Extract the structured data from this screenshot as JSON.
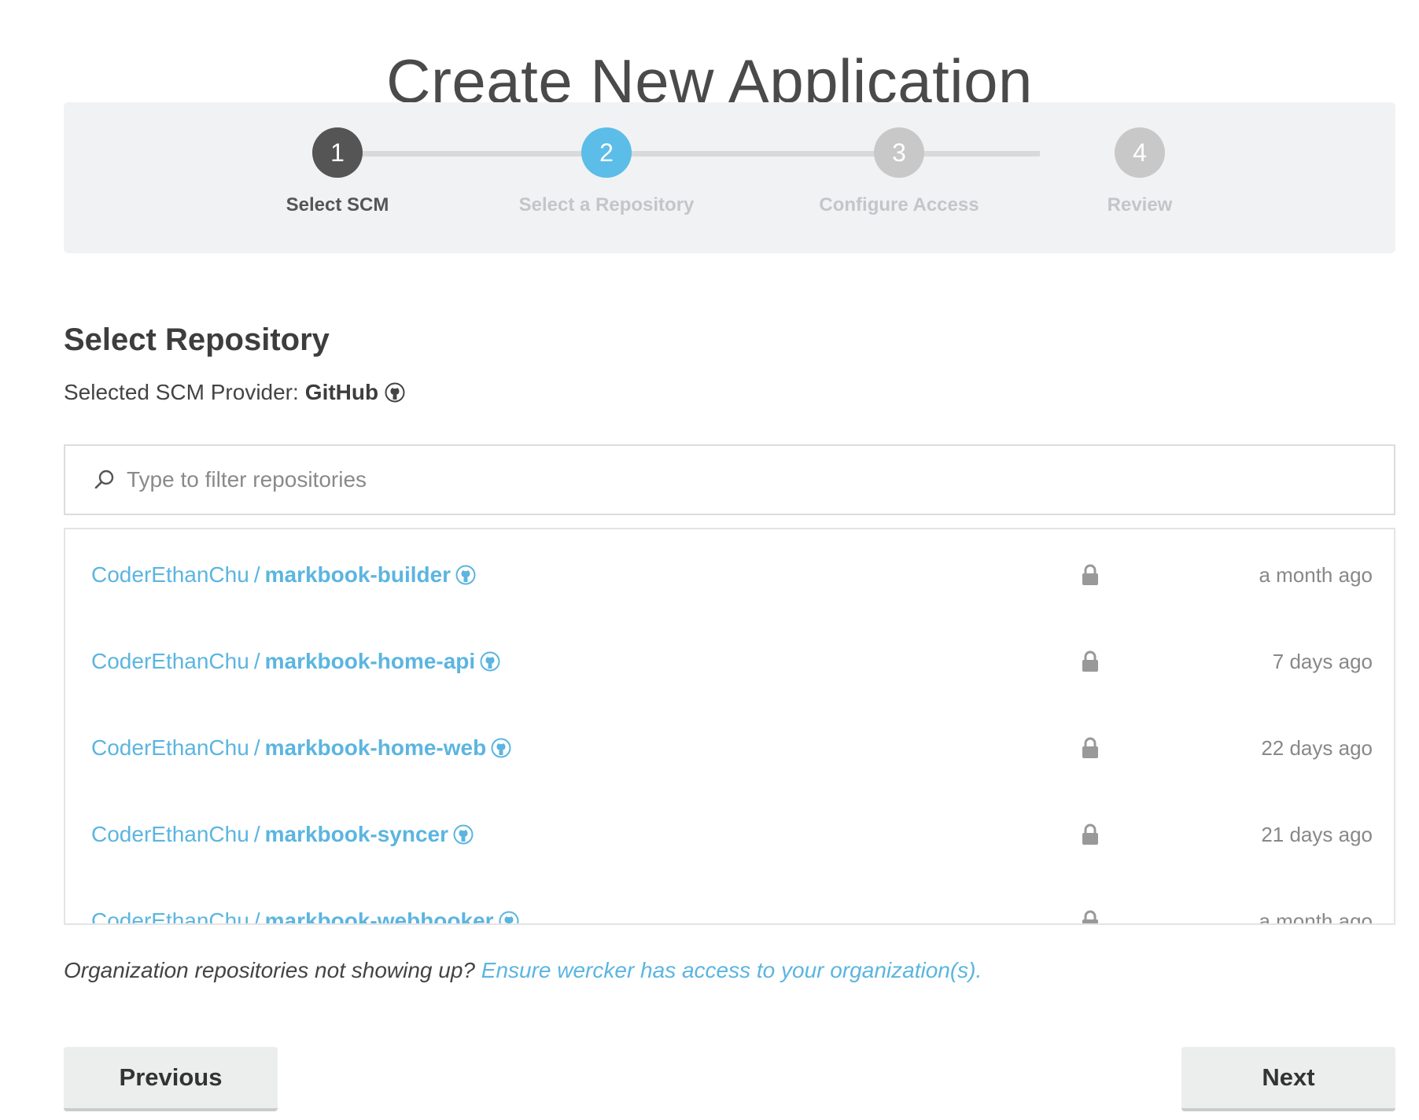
{
  "page": {
    "title": "Create New Application"
  },
  "stepper": {
    "steps": [
      {
        "number": "1",
        "label": "Select SCM",
        "state": "done"
      },
      {
        "number": "2",
        "label": "Select a Repository",
        "state": "active"
      },
      {
        "number": "3",
        "label": "Configure Access",
        "state": "pending"
      },
      {
        "number": "4",
        "label": "Review",
        "state": "pending"
      }
    ]
  },
  "section": {
    "title": "Select Repository",
    "provider_label": "Selected SCM Provider:",
    "provider_name": "GitHub"
  },
  "search": {
    "placeholder": "Type to filter repositories",
    "value": ""
  },
  "repos": [
    {
      "owner": "CoderEthanChu",
      "separator": "/",
      "name": "markbook-builder",
      "updated": "a month ago",
      "private": true
    },
    {
      "owner": "CoderEthanChu",
      "separator": "/",
      "name": "markbook-home-api",
      "updated": "7 days ago",
      "private": true
    },
    {
      "owner": "CoderEthanChu",
      "separator": "/",
      "name": "markbook-home-web",
      "updated": "22 days ago",
      "private": true
    },
    {
      "owner": "CoderEthanChu",
      "separator": "/",
      "name": "markbook-syncer",
      "updated": "21 days ago",
      "private": true
    },
    {
      "owner": "CoderEthanChu",
      "separator": "/",
      "name": "markbook-webhooker",
      "updated": "a month ago",
      "private": true
    }
  ],
  "org_note": {
    "question": "Organization repositories not showing up?",
    "link": "Ensure wercker has access to your organization(s)."
  },
  "buttons": {
    "previous": "Previous",
    "next": "Next"
  },
  "colors": {
    "accent": "#5bbde8",
    "link": "#5bb5e0",
    "step_done": "#555555",
    "step_pending": "#c8c8c8"
  },
  "icons": {
    "provider": "github-icon",
    "search": "search-icon",
    "lock": "lock-icon"
  }
}
